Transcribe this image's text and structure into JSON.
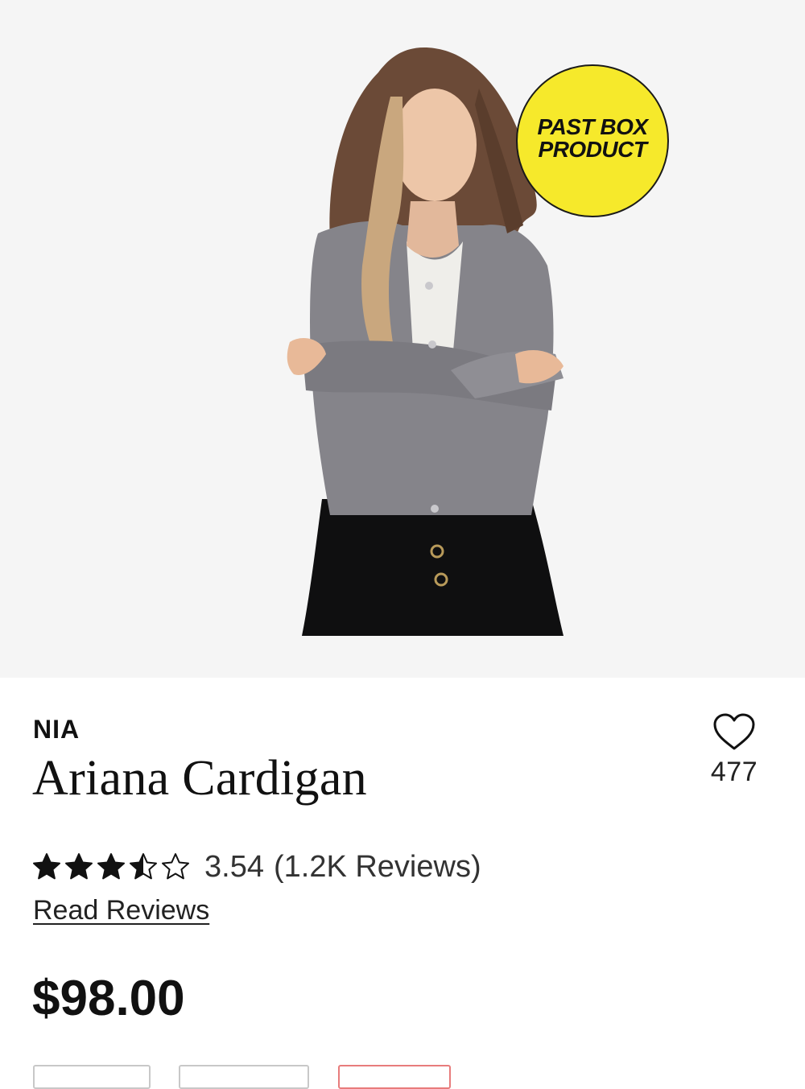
{
  "hero": {
    "badge_text": "PAST BOX\nPRODUCT"
  },
  "product": {
    "brand": "NIA",
    "name": "Ariana Cardigan",
    "favorites_count": "477",
    "rating_value": "3.54",
    "rating_stars": 3.54,
    "reviews_count": "(1.2K Reviews)",
    "read_reviews_label": "Read Reviews",
    "price": "$98.00"
  },
  "colors": {
    "badge_yellow": "#f6e92b",
    "selected_outline": "#e87c7c",
    "text": "#111111"
  }
}
